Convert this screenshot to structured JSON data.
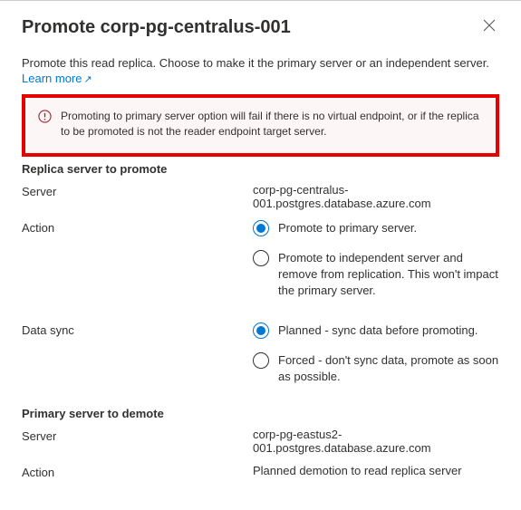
{
  "header": {
    "title": "Promote corp-pg-centralus-001"
  },
  "intro": {
    "text": "Promote this read replica. Choose to make it the primary server or an independent server.",
    "learn_more": "Learn more"
  },
  "alert": {
    "text": "Promoting to primary server option will fail if there is no virtual endpoint, or if the replica to be promoted is not the reader endpoint target server."
  },
  "replica_section": {
    "title": "Replica server to promote",
    "server_label": "Server",
    "server_value": "corp-pg-centralus-001.postgres.database.azure.com",
    "action_label": "Action",
    "action_options": [
      {
        "label": "Promote to primary server.",
        "selected": true
      },
      {
        "label": "Promote to independent server and remove from replication. This won't impact the primary server.",
        "selected": false
      }
    ],
    "sync_label": "Data sync",
    "sync_options": [
      {
        "label": "Planned - sync data before promoting.",
        "selected": true
      },
      {
        "label": "Forced - don't sync data, promote as soon as possible.",
        "selected": false
      }
    ]
  },
  "primary_section": {
    "title": "Primary server to demote",
    "server_label": "Server",
    "server_value": "corp-pg-eastus2-001.postgres.database.azure.com",
    "action_label": "Action",
    "action_value": "Planned demotion to read replica server"
  }
}
